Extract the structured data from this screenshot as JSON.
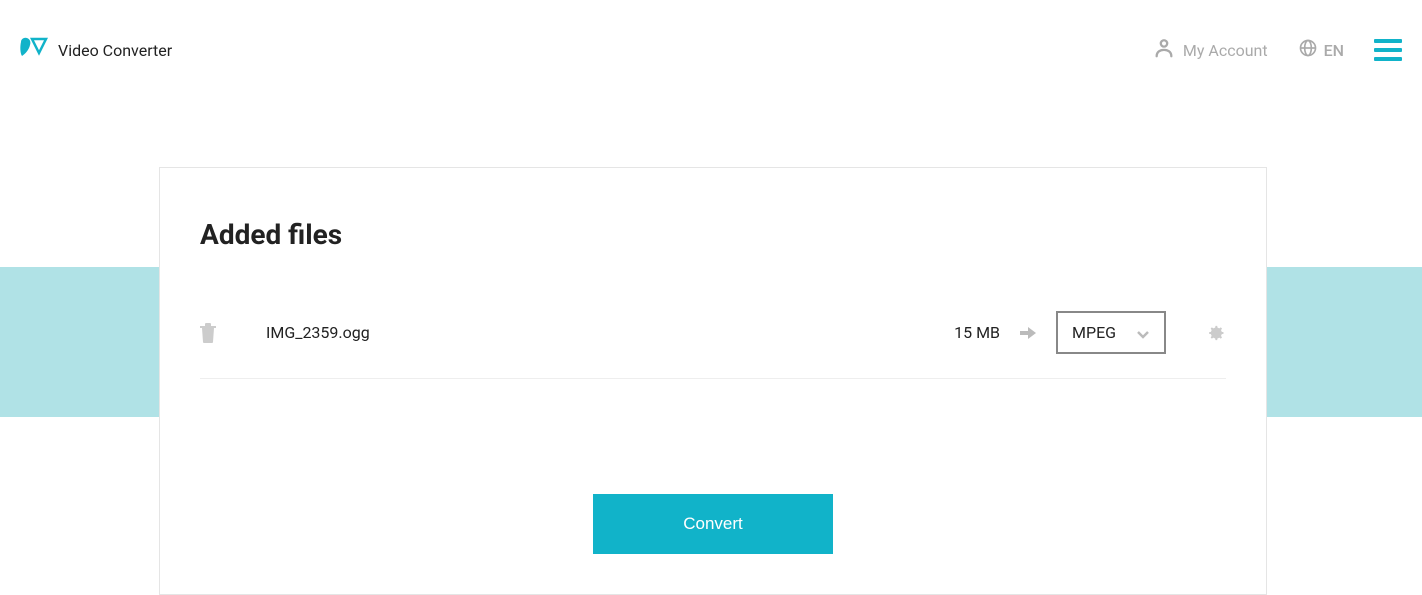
{
  "header": {
    "brand_name": "Video Converter",
    "my_account_label": "My Account",
    "language_label": "EN"
  },
  "card": {
    "title": "Added files",
    "convert_button_label": "Convert"
  },
  "files": [
    {
      "name": "IMG_2359.ogg",
      "size": "15 MB",
      "format": "MPEG"
    }
  ],
  "colors": {
    "accent": "#11b3c9",
    "strip": "#b0e2e6",
    "muted": "#aaa"
  }
}
